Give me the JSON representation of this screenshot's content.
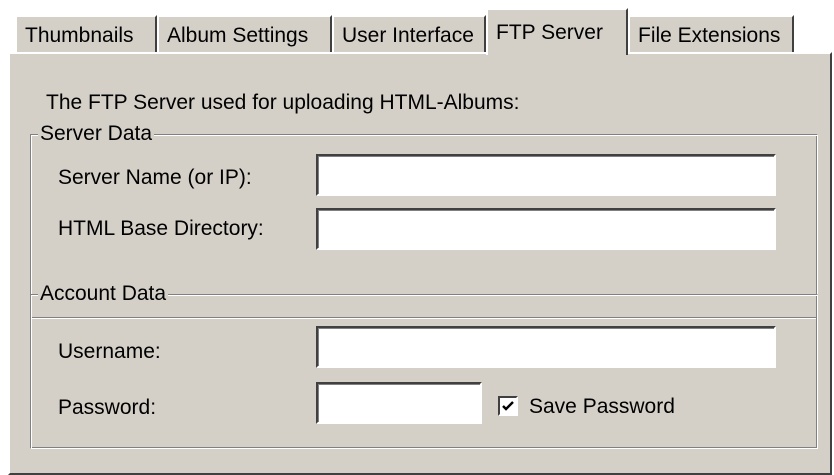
{
  "tabs": [
    {
      "label": "Thumbnails",
      "active": false
    },
    {
      "label": "Album Settings",
      "active": false
    },
    {
      "label": "User Interface",
      "active": false
    },
    {
      "label": "FTP Server",
      "active": true
    },
    {
      "label": "File Extensions",
      "active": false
    }
  ],
  "panel": {
    "description": "The FTP Server used for uploading HTML-Albums:",
    "server_data": {
      "legend": "Server Data",
      "server_name_label": "Server Name (or IP):",
      "server_name_value": "",
      "base_dir_label": "HTML Base Directory:",
      "base_dir_value": ""
    },
    "account_data": {
      "legend": "Account Data",
      "username_label": "Username:",
      "username_value": "",
      "password_label": "Password:",
      "password_value": "",
      "save_password_label": "Save Password",
      "save_password_checked": true
    }
  },
  "colors": {
    "face": "#d4d0c8",
    "highlight": "#ffffff",
    "shadow": "#808080",
    "dark_shadow": "#404040"
  }
}
